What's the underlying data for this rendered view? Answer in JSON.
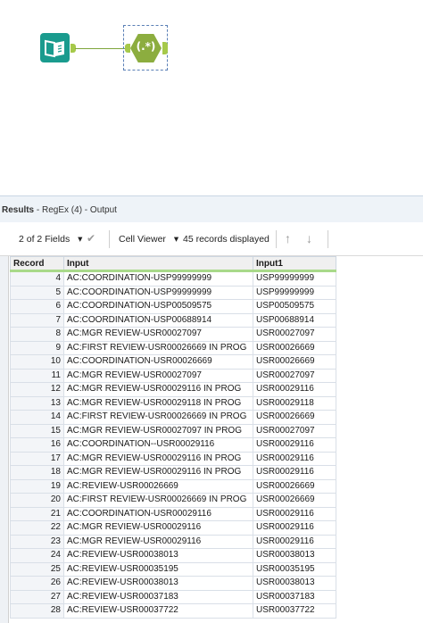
{
  "results": {
    "title_bold": "Results",
    "title_rest": " - RegEx (4) - Output"
  },
  "toolbar": {
    "fields_label": "2 of 2 Fields",
    "dropdown_glyph": "▾",
    "check_glyph": "✔",
    "cell_viewer_label": "Cell Viewer",
    "records_displayed": "45 records displayed",
    "up_glyph": "↑",
    "down_glyph": "↓"
  },
  "canvas": {
    "regex_glyph": "(.*)"
  },
  "grid": {
    "columns": [
      "Record",
      "Input",
      "Input1"
    ],
    "rows": [
      [
        "4",
        "AC:COORDINATION-USP99999999",
        "USP99999999"
      ],
      [
        "5",
        "AC:COORDINATION-USP99999999",
        "USP99999999"
      ],
      [
        "6",
        "AC:COORDINATION-USP00509575",
        "USP00509575"
      ],
      [
        "7",
        "AC:COORDINATION-USP00688914",
        "USP00688914"
      ],
      [
        "8",
        "AC:MGR REVIEW-USR00027097",
        "USR00027097"
      ],
      [
        "9",
        "AC:FIRST REVIEW-USR00026669 IN PROG",
        "USR00026669"
      ],
      [
        "10",
        "AC:COORDINATION-USR00026669",
        "USR00026669"
      ],
      [
        "11",
        "AC:MGR REVIEW-USR00027097",
        "USR00027097"
      ],
      [
        "12",
        "AC:MGR REVIEW-USR00029116 IN PROG",
        "USR00029116"
      ],
      [
        "13",
        "AC:MGR REVIEW-USR00029118 IN PROG",
        "USR00029118"
      ],
      [
        "14",
        "AC:FIRST REVIEW-USR00026669 IN PROG",
        "USR00026669"
      ],
      [
        "15",
        "AC:MGR REVIEW-USR00027097 IN PROG",
        "USR00027097"
      ],
      [
        "16",
        "AC:COORDINATION--USR00029116",
        "USR00029116"
      ],
      [
        "17",
        "AC:MGR REVIEW-USR00029116 IN PROG",
        "USR00029116"
      ],
      [
        "18",
        "AC:MGR REVIEW-USR00029116 IN PROG",
        "USR00029116"
      ],
      [
        "19",
        "AC:REVIEW-USR00026669",
        "USR00026669"
      ],
      [
        "20",
        "AC:FIRST REVIEW-USR00026669 IN PROG",
        "USR00026669"
      ],
      [
        "21",
        "AC:COORDINATION-USR00029116",
        "USR00029116"
      ],
      [
        "22",
        "AC:MGR REVIEW-USR00029116",
        "USR00029116"
      ],
      [
        "23",
        "AC:MGR REVIEW-USR00029116",
        "USR00029116"
      ],
      [
        "24",
        "AC:REVIEW-USR00038013",
        "USR00038013"
      ],
      [
        "25",
        "AC:REVIEW-USR00035195",
        "USR00035195"
      ],
      [
        "26",
        "AC:REVIEW-USR00038013",
        "USR00038013"
      ],
      [
        "27",
        "AC:REVIEW-USR00037183",
        "USR00037183"
      ],
      [
        "28",
        "AC:REVIEW-USR00037722",
        "USR00037722"
      ]
    ]
  },
  "colors": {
    "input_tool": "#1a9b8e",
    "regex_tool": "#8cad3f",
    "connector": "#7fa63c"
  }
}
